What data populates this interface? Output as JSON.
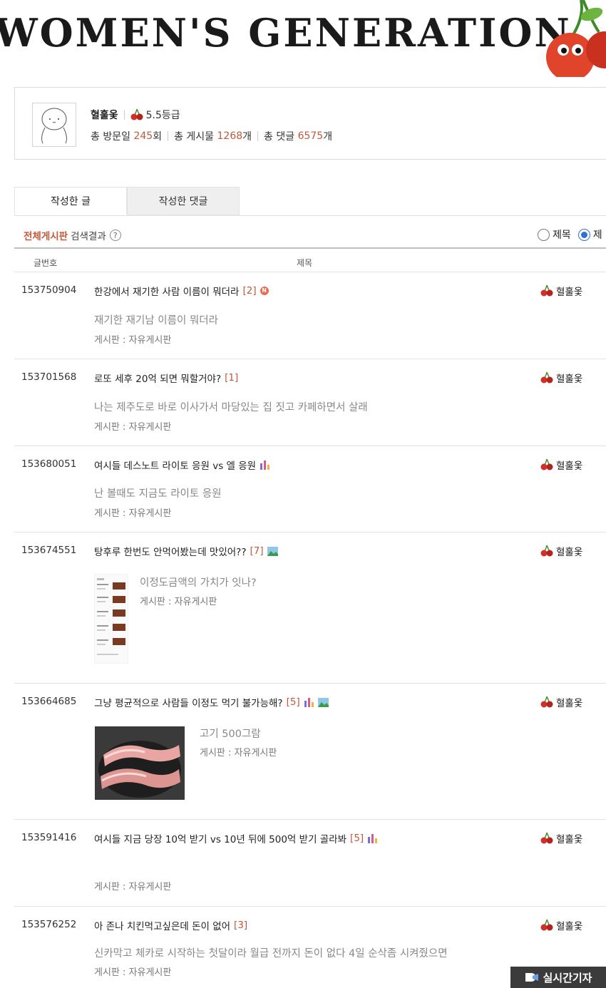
{
  "banner": {
    "title": "WOMEN'S GENERATION"
  },
  "profile": {
    "name": "혈훌옻",
    "grade": "5.5등급",
    "visits_label": "총 방문일",
    "visits": "245",
    "visits_unit": "회",
    "posts_label": "총 게시물",
    "posts": "1268",
    "posts_unit": "개",
    "comments_label": "총 댓글",
    "comments": "6575",
    "comments_unit": "개"
  },
  "tabs": {
    "written_posts": "작성한 글",
    "written_comments": "작성한 댓글"
  },
  "filter": {
    "board": "전체게시판",
    "result": "검색결과",
    "help": "?",
    "radio_title": "제목",
    "radio_second": "제"
  },
  "table": {
    "col_num": "글번호",
    "col_title": "제목"
  },
  "posts": [
    {
      "num": "153750904",
      "title": "한강에서 재기한 사람 이름이 뭐더라",
      "comments": "[2]",
      "preview": "재기한 재기남 이름이 뭐더라",
      "board": "게시판 : 자유게시판",
      "author": "혈훌옻"
    },
    {
      "num": "153701568",
      "title": "로또 세후 20억 되면 뭐할거야?",
      "comments": "[1]",
      "preview": "나는 제주도로 바로 이사가서 마당있는 집 짓고 카페하면서 살래",
      "board": "게시판 : 자유게시판",
      "author": "혈훌옻"
    },
    {
      "num": "153680051",
      "title": "여시들 데스노트 라이토 응원 vs 엘 응원",
      "comments": "",
      "preview": "난 볼때도 지금도 라이토 응원",
      "board": "게시판 : 자유게시판",
      "author": "혈훌옻"
    },
    {
      "num": "153674551",
      "title": "탕후루 한번도 안먹어봤는데 맛있어??",
      "comments": "[7]",
      "preview": "이정도금액의 가치가 잇나?",
      "board": "게시판 : 자유게시판",
      "author": "혈훌옻"
    },
    {
      "num": "153664685",
      "title": "그냥 평균적으로 사람들 이정도 먹기 불가능해?",
      "comments": "[5]",
      "preview": "고기 500그람",
      "board": "게시판 : 자유게시판",
      "author": "혈훌옻"
    },
    {
      "num": "153591416",
      "title": "여시들 지금 당장 10억 받기 vs 10년 뒤에 500억 받기 골라봐",
      "comments": "[5]",
      "preview": "",
      "board": "게시판 : 자유게시판",
      "author": "혈훌옻"
    },
    {
      "num": "153576252",
      "title": "아 존나 치킨먹고싶은데 돈이 없어",
      "comments": "[3]",
      "preview": "신카막고 체카로 시작하는 첫달이라 월급 전까지 돈이 없다 4일 순삭좀 시켜줬으면",
      "board": "게시판 : 자유게시판",
      "author": "혈훌옻"
    }
  ],
  "watermark": {
    "text": "실시간기자"
  },
  "colors": {
    "accent": "#c4593a",
    "radio_blue": "#2f6fd6",
    "cherry": "#d0302b"
  },
  "icons": [
    "cherry-icon",
    "new-icon",
    "poll-icon",
    "image-icon",
    "help-icon"
  ]
}
